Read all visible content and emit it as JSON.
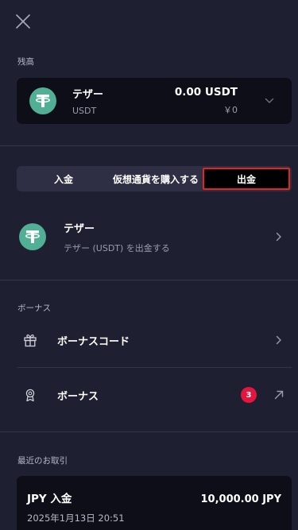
{
  "colors": {
    "background": "#1e1f30",
    "card": "#0d0e17",
    "tether": "#50af95",
    "highlight_border": "#e32420",
    "badge": "#e3163f"
  },
  "balance": {
    "section_label": "残高",
    "coin_icon": "tether-icon",
    "name": "テザー",
    "ticker": "USDT",
    "amount": "0.00 USDT",
    "fiat": "￥0"
  },
  "tabs": [
    {
      "label": "入金",
      "selected": false
    },
    {
      "label": "仮想通貨を購入する",
      "selected": false
    },
    {
      "label": "出金",
      "selected": true
    }
  ],
  "withdraw_asset": {
    "name": "テザー",
    "description": "テザー (USDT) を出金する"
  },
  "bonus": {
    "section_label": "ボーナス",
    "items": [
      {
        "icon": "gift-icon",
        "label": "ボーナスコード"
      },
      {
        "icon": "award-icon",
        "label": "ボーナス",
        "badge": "3"
      }
    ]
  },
  "recent": {
    "section_label": "最近のお取引",
    "transactions": [
      {
        "title": "JPY 入金",
        "amount": "10,000.00 JPY",
        "date": "2025年1月13日 20:51"
      }
    ]
  }
}
